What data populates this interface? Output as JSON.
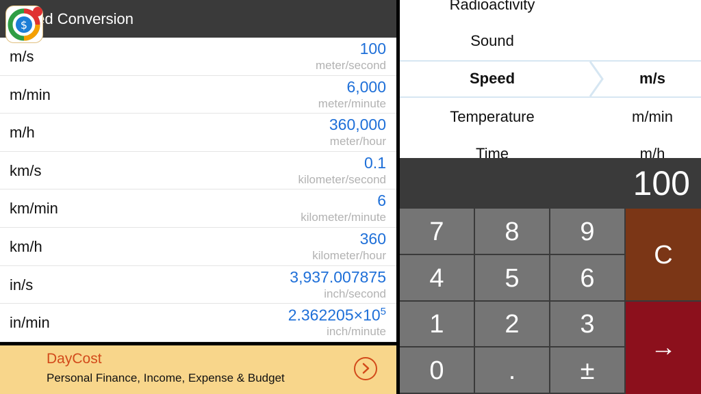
{
  "header": {
    "title": "Speed Conversion"
  },
  "conversions": [
    {
      "abbr": "m/s",
      "value": "100",
      "unit_name": "meter/second"
    },
    {
      "abbr": "m/min",
      "value": "6,000",
      "unit_name": "meter/minute"
    },
    {
      "abbr": "m/h",
      "value": "360,000",
      "unit_name": "meter/hour"
    },
    {
      "abbr": "km/s",
      "value": "0.1",
      "unit_name": "kilometer/second"
    },
    {
      "abbr": "km/min",
      "value": "6",
      "unit_name": "kilometer/minute"
    },
    {
      "abbr": "km/h",
      "value": "360",
      "unit_name": "kilometer/hour"
    },
    {
      "abbr": "in/s",
      "value": "3,937.007875",
      "unit_name": "inch/second"
    },
    {
      "abbr": "in/min",
      "value_mantissa": "2.362205×10",
      "value_exponent": "5",
      "unit_name": "inch/minute"
    }
  ],
  "ad": {
    "title": "DayCost",
    "subtitle": "Personal Finance, Income, Expense & Budget",
    "icon": "daycost-app-icon",
    "arrow_icon": "chevron-right-circle-icon"
  },
  "picker": {
    "categories": [
      "Radioactivity",
      "Sound",
      "Speed",
      "Temperature",
      "Time"
    ],
    "selected_category": "Speed",
    "units": [
      "m/s",
      "m/min",
      "m/h"
    ],
    "selected_unit": "m/s",
    "accent_color": "#d6e6f2"
  },
  "calculator": {
    "display": "100",
    "keys": {
      "k7": "7",
      "k8": "8",
      "k9": "9",
      "k4": "4",
      "k5": "5",
      "k6": "6",
      "k1": "1",
      "k2": "2",
      "k3": "3",
      "k0": "0",
      "dot": ".",
      "sign": "±",
      "clear": "C",
      "enter": "→"
    },
    "colors": {
      "digit": "#757575",
      "clear": "#7b3616",
      "enter": "#8c101c"
    }
  }
}
